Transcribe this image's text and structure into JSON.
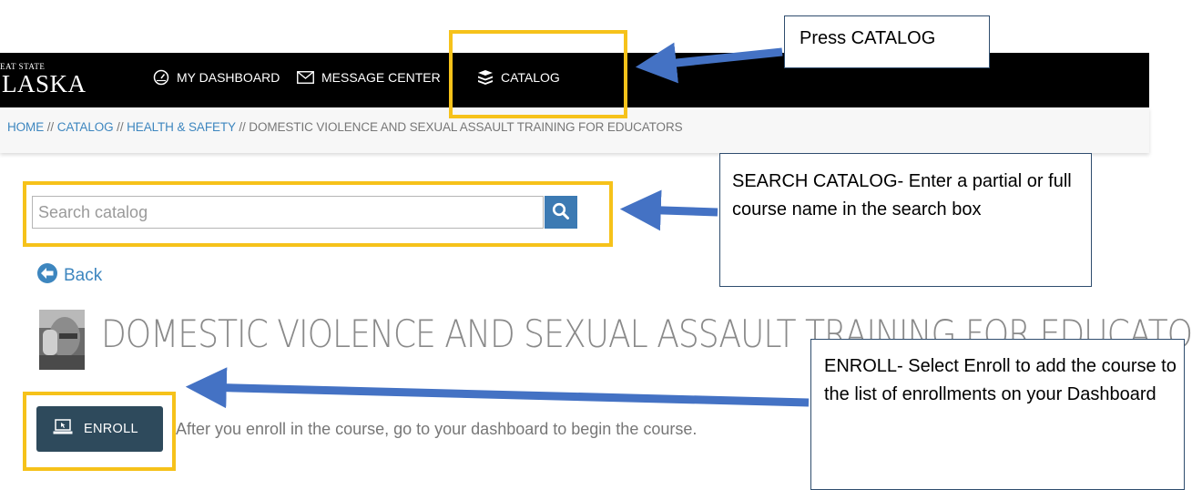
{
  "nav": {
    "logo_small": "EAT STATE",
    "logo_big": "LASKA",
    "items": [
      {
        "label": "MY DASHBOARD",
        "icon": "gauge-icon"
      },
      {
        "label": "MESSAGE CENTER",
        "icon": "envelope-icon"
      },
      {
        "label": "CATALOG",
        "icon": "books-icon"
      }
    ]
  },
  "breadcrumb": {
    "home": "HOME",
    "catalog": "CATALOG",
    "category": "HEALTH & SAFETY",
    "current": "DOMESTIC VIOLENCE AND SEXUAL ASSAULT TRAINING FOR EDUCATORS",
    "separator": " // "
  },
  "search": {
    "placeholder": "Search catalog",
    "value": "",
    "icon": "search-icon"
  },
  "back": {
    "label": "Back",
    "icon": "arrow-left-circle-icon"
  },
  "course": {
    "title": "DOMESTIC VIOLENCE AND SEXUAL ASSAULT TRAINING FOR EDUCATORS",
    "enroll_label": "ENROLL",
    "enroll_icon": "laptop-icon",
    "enroll_note": "After you enroll in the course, go to your dashboard to begin the course."
  },
  "annotations": {
    "catalog": "Press CATALOG",
    "search": "SEARCH CATALOG- Enter a partial or full course name in the search box",
    "enroll": "ENROLL- Select Enroll to add the course to the list of enrollments on your Dashboard"
  },
  "colors": {
    "highlight": "#f6c21a",
    "arrow": "#4472c4",
    "link": "#3d86bf",
    "enroll_button": "#2e4a5c",
    "search_button": "#3c7ab3"
  }
}
